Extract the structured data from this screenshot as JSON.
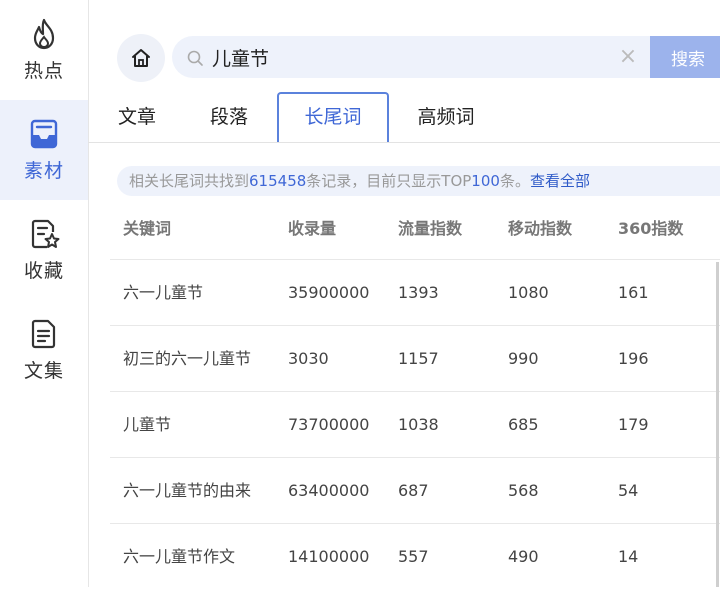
{
  "sidebar": {
    "items": [
      {
        "label": "热点",
        "icon": "flame-icon",
        "active": false
      },
      {
        "label": "素材",
        "icon": "inbox-tray-icon",
        "active": true
      },
      {
        "label": "收藏",
        "icon": "document-star-icon",
        "active": false
      },
      {
        "label": "文集",
        "icon": "document-list-icon",
        "active": false
      }
    ]
  },
  "search": {
    "value": "儿童节",
    "clear_symbol": "×",
    "button_label": "搜索"
  },
  "tabs": [
    {
      "label": "文章",
      "active": false
    },
    {
      "label": "段落",
      "active": false
    },
    {
      "label": "长尾词",
      "active": true
    },
    {
      "label": "高频词",
      "active": false
    }
  ],
  "info": {
    "prefix": "相关长尾词共找到",
    "count": "615458",
    "middle": "条记录，目前只显示TOP",
    "top": "100",
    "suffix": "条。",
    "link": "查看全部"
  },
  "table": {
    "headers": [
      "关键词",
      "收录量",
      "流量指数",
      "移动指数",
      "360指数"
    ],
    "rows": [
      [
        "六一儿童节",
        "35900000",
        "1393",
        "1080",
        "161"
      ],
      [
        "初三的六一儿童节",
        "3030",
        "1157",
        "990",
        "196"
      ],
      [
        "儿童节",
        "73700000",
        "1038",
        "685",
        "179"
      ],
      [
        "六一儿童节的由来",
        "63400000",
        "687",
        "568",
        "54"
      ],
      [
        "六一儿童节作文",
        "14100000",
        "557",
        "490",
        "14"
      ]
    ]
  },
  "colors": {
    "accent": "#3f67d6",
    "search_button": "#9cb3ec",
    "active_bg": "#edf1fb"
  }
}
